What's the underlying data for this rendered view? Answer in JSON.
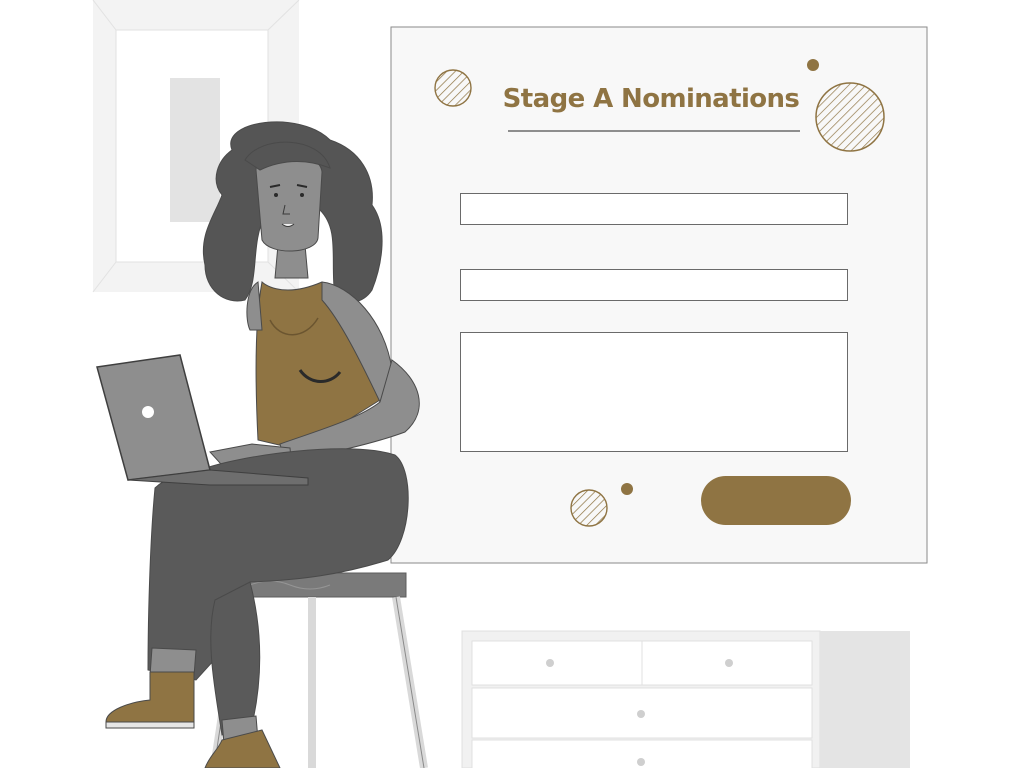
{
  "form": {
    "title": "Stage A Nominations"
  },
  "icons": {
    "person": "woman-with-laptop",
    "decor": [
      "hatched-circle",
      "dot"
    ]
  },
  "colors": {
    "accent": "#8f7443",
    "form_background": "#f8f8f8",
    "outline": "#6a6a6a",
    "skin": "#8e8e8e",
    "hair": "#555555",
    "pants": "#5a5a5a",
    "wall_frame": "#ececec"
  }
}
